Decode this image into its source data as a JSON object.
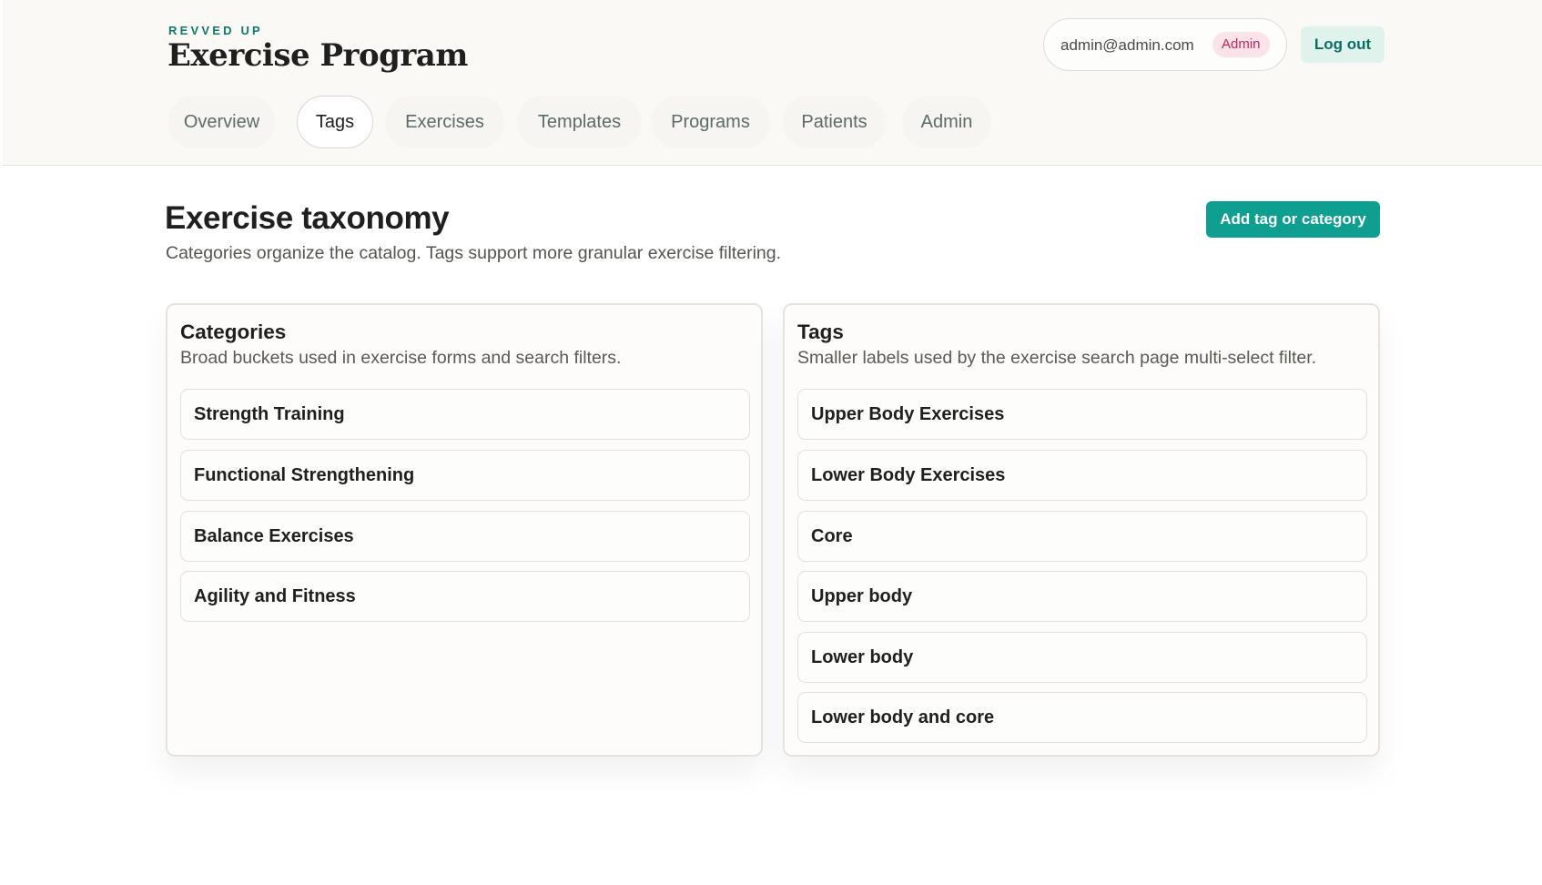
{
  "brand": {
    "kicker": "REVVED UP",
    "title": "Exercise Program"
  },
  "user": {
    "email": "admin@admin.com",
    "role": "Admin",
    "logout_label": "Log out"
  },
  "nav": {
    "tabs": [
      {
        "label": "Overview",
        "active": false
      },
      {
        "label": "Tags",
        "active": true
      },
      {
        "label": "Exercises",
        "active": false
      },
      {
        "label": "Templates",
        "active": false
      },
      {
        "label": "Programs",
        "active": false
      },
      {
        "label": "Patients",
        "active": false
      },
      {
        "label": "Admin",
        "active": false
      }
    ]
  },
  "page": {
    "title": "Exercise taxonomy",
    "subtitle": "Categories organize the catalog. Tags support more granular exercise filtering.",
    "add_label": "Add tag or category"
  },
  "categories": {
    "title": "Categories",
    "subtitle": "Broad buckets used in exercise forms and search filters.",
    "items": [
      "Strength Training",
      "Functional Strengthening",
      "Balance Exercises",
      "Agility and Fitness"
    ]
  },
  "tags": {
    "title": "Tags",
    "subtitle": "Smaller labels used by the exercise search page multi-select filter.",
    "items": [
      "Upper Body Exercises",
      "Lower Body Exercises",
      "Core",
      "Upper body",
      "Lower body",
      "Lower body and core"
    ]
  },
  "colors": {
    "accent": "#0f9f90",
    "brand_kicker": "#0d7a70",
    "admin_badge_bg": "#fbe3ea",
    "admin_badge_text": "#c2255c"
  }
}
